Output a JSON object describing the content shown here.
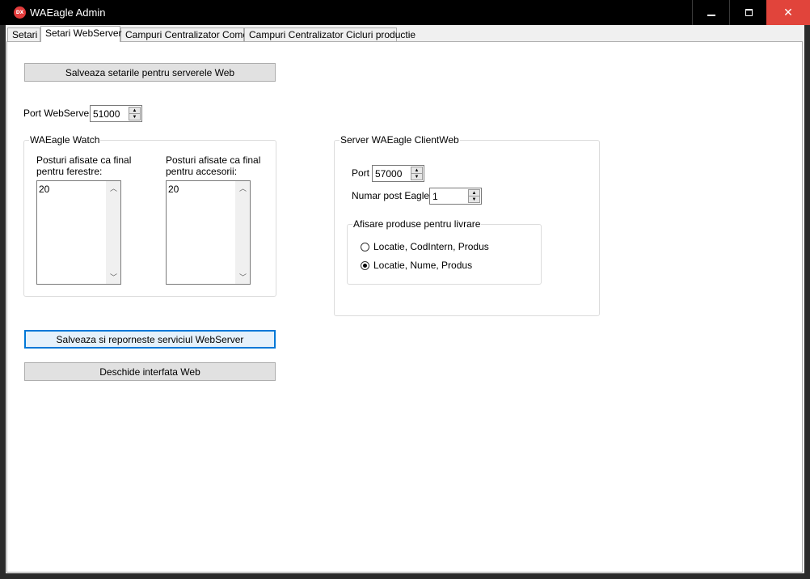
{
  "window": {
    "title": "WAEagle Admin",
    "icon_text": "DX",
    "minimize_label": "",
    "close_glyph": "✕"
  },
  "tabs": [
    {
      "label": "Setari",
      "active": false
    },
    {
      "label": "Setari WebServer",
      "active": true
    },
    {
      "label": "Campuri Centralizator Comenzi",
      "active": false
    },
    {
      "label": "Campuri Centralizator Cicluri productie",
      "active": false
    }
  ],
  "buttons": {
    "save_web_settings": "Salveaza setarile pentru serverele Web",
    "save_restart_service": "Salveaza si reporneste serviciul WebServer",
    "open_web_interface": "Deschide interfata Web"
  },
  "port_webserver": {
    "label": "Port WebServer",
    "value": "51000"
  },
  "waeagle_watch": {
    "title": "WAEagle Watch",
    "windows_posts": {
      "label_line1": "Posturi afisate ca final",
      "label_line2": "pentru ferestre:",
      "items": [
        "20"
      ]
    },
    "accessories_posts": {
      "label_line1": "Posturi afisate ca final",
      "label_line2": "pentru accesorii:",
      "items": [
        "20"
      ]
    }
  },
  "client_web": {
    "title": "Server WAEagle ClientWeb",
    "port_label": "Port",
    "port_value": "57000",
    "post_label": "Numar post Eagle",
    "post_value": "1",
    "display_group": {
      "title": "Afisare produse pentru livrare",
      "options": [
        {
          "label": "Locatie, CodIntern, Produs",
          "checked": false
        },
        {
          "label": "Locatie, Nume, Produs",
          "checked": true
        }
      ]
    }
  },
  "icons": {
    "spin_up": "▲",
    "spin_down": "▼",
    "scroll_up": "︿",
    "scroll_down": "﹀"
  }
}
